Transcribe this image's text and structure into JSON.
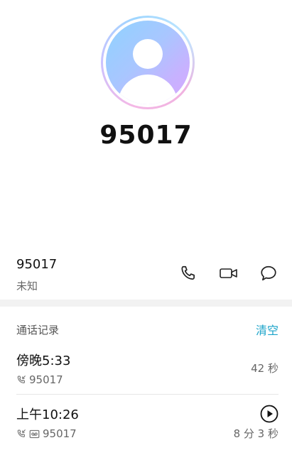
{
  "contact": {
    "name": "95017"
  },
  "number_row": {
    "number": "95017",
    "location": "未知"
  },
  "call_log": {
    "title": "通话记录",
    "clear_label": "清空",
    "items": [
      {
        "time": "傍晚5:33",
        "number": "95017",
        "duration": "42 秒"
      },
      {
        "time": "上午10:26",
        "number": "95017",
        "duration": "8 分 3 秒"
      }
    ]
  },
  "colors": {
    "accent": "#1aa3c9"
  }
}
